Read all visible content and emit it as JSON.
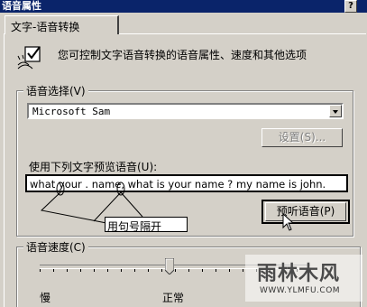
{
  "window": {
    "title": "语音属性",
    "help_button": "?"
  },
  "tabs": [
    {
      "label": "文字-语音转换",
      "selected": true
    }
  ],
  "intro": {
    "text": "您可控制文字语音转换的语音属性、速度和其他选项",
    "icon": "checkbox-speech-icon"
  },
  "voice_selection": {
    "label": "语音选择(V)",
    "selected_voice": "Microsoft Sam",
    "settings_button": "设置(S)...",
    "settings_enabled": false
  },
  "preview": {
    "label": "使用下列文字预览语音(U):",
    "text": "what your . name, what is your name ? my name is john.",
    "button_label": "预听语音(P)"
  },
  "annotation": {
    "text": "用句号隔开"
  },
  "speed": {
    "label": "语音速度(C)",
    "slow_label": "慢",
    "normal_label": "正常",
    "level": 0.48
  },
  "watermark": {
    "brand": "雨林木风",
    "url": "WWW.YLMFU.COM"
  }
}
